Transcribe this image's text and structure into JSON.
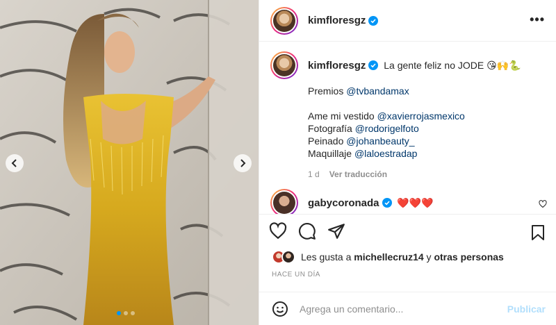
{
  "post": {
    "author": "kimfloresgz",
    "more_label": "•••"
  },
  "caption": {
    "username": "kimfloresgz",
    "line1": "La gente feliz no JODE 😘🙌🐍",
    "awards_prefix": "Premios ",
    "awards_mention": "@tvbandamax",
    "dress_prefix": "Ame mi vestido ",
    "dress_mention": "@xavierrojasmexico",
    "photo_prefix": "Fotografía ",
    "photo_mention": "@rodorigelfoto",
    "hair_prefix": "Peinado ",
    "hair_mention": "@johanbeauty_",
    "makeup_prefix": "Maquillaje ",
    "makeup_mention": "@laloestradap",
    "age": "1 d",
    "translate": "Ver traducción"
  },
  "comment": {
    "username": "gabycoronada",
    "text": "❤️❤️❤️"
  },
  "likes": {
    "prefix": "Les gusta a ",
    "user": "michellecruz14",
    "middle": " y ",
    "others": "otras personas"
  },
  "timestamp": "HACE UN DÍA",
  "composer": {
    "placeholder": "Agrega un comentario...",
    "publish": "Publicar"
  },
  "colors": {
    "verified": "#0095f6",
    "mention": "#00376b",
    "publish_disabled": "#b2dffc"
  }
}
